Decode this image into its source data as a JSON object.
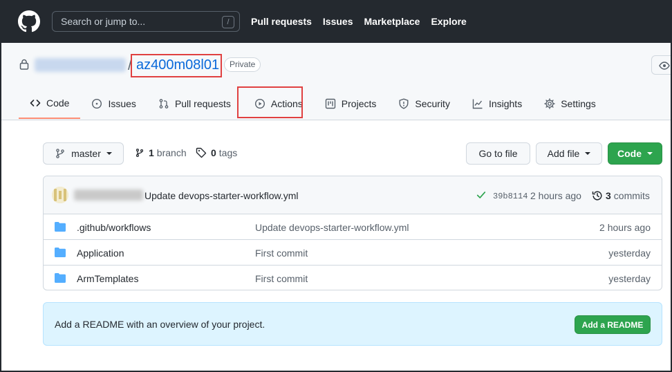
{
  "header": {
    "logo_icon": "github-mark-icon",
    "search_placeholder": "Search or jump to...",
    "search_shortcut": "/",
    "nav": [
      "Pull requests",
      "Issues",
      "Marketplace",
      "Explore"
    ]
  },
  "repo": {
    "visibility_icon": "lock-icon",
    "separator": "/",
    "name": "az400m08l01",
    "visibility_label": "Private",
    "watch_icon": "eye-icon"
  },
  "tabs": [
    {
      "label": "Code",
      "icon": "code-icon",
      "selected": true
    },
    {
      "label": "Issues",
      "icon": "issue-opened-icon"
    },
    {
      "label": "Pull requests",
      "icon": "git-pull-request-icon"
    },
    {
      "label": "Actions",
      "icon": "play-icon"
    },
    {
      "label": "Projects",
      "icon": "project-icon"
    },
    {
      "label": "Security",
      "icon": "shield-icon"
    },
    {
      "label": "Insights",
      "icon": "graph-icon"
    },
    {
      "label": "Settings",
      "icon": "gear-icon"
    }
  ],
  "branch_bar": {
    "branch_name": "master",
    "branch_count": "1",
    "branch_label": "branch",
    "tag_count": "0",
    "tag_label": "tags",
    "go_to_file": "Go to file",
    "add_file": "Add file",
    "code": "Code"
  },
  "latest_commit": {
    "message": "Update devops-starter-workflow.yml",
    "sha": "39b8114",
    "time": "2 hours ago",
    "commit_count": "3",
    "commit_label": "commits"
  },
  "files": [
    {
      "name": ".github/workflows",
      "message": "Update devops-starter-workflow.yml",
      "time": "2 hours ago"
    },
    {
      "name": "Application",
      "message": "First commit",
      "time": "yesterday"
    },
    {
      "name": "ArmTemplates",
      "message": "First commit",
      "time": "yesterday"
    }
  ],
  "readme_banner": {
    "text": "Add a README with an overview of your project.",
    "button": "Add a README"
  },
  "colors": {
    "header_bg": "#24292f",
    "link_blue": "#0969da",
    "primary_green": "#2da44e",
    "tab_underline": "#fd8c73",
    "highlight_red": "#e04040",
    "folder_blue": "#54aeff"
  }
}
